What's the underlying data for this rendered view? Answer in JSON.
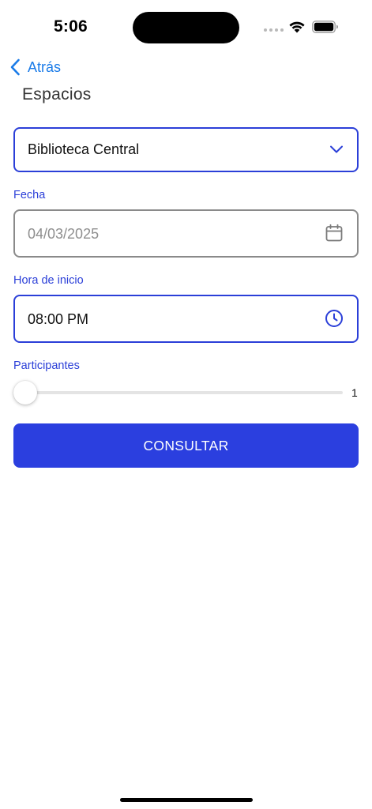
{
  "status_bar": {
    "time": "5:06"
  },
  "nav": {
    "back_label": "Atrás",
    "title": "Espacios"
  },
  "space_select": {
    "value": "Biblioteca Central"
  },
  "date_field": {
    "label": "Fecha",
    "value": "04/03/2025",
    "icon": "calendar-icon"
  },
  "time_field": {
    "label": "Hora de inicio",
    "value": "08:00 PM",
    "icon": "clock-icon"
  },
  "participants": {
    "label": "Participantes",
    "value": "1",
    "slider_fraction": 0
  },
  "actions": {
    "submit_label": "CONSULTAR"
  },
  "colors": {
    "accent": "#2b3fdf",
    "link": "#1a7be8",
    "disabled_border": "#8a8a8a"
  }
}
